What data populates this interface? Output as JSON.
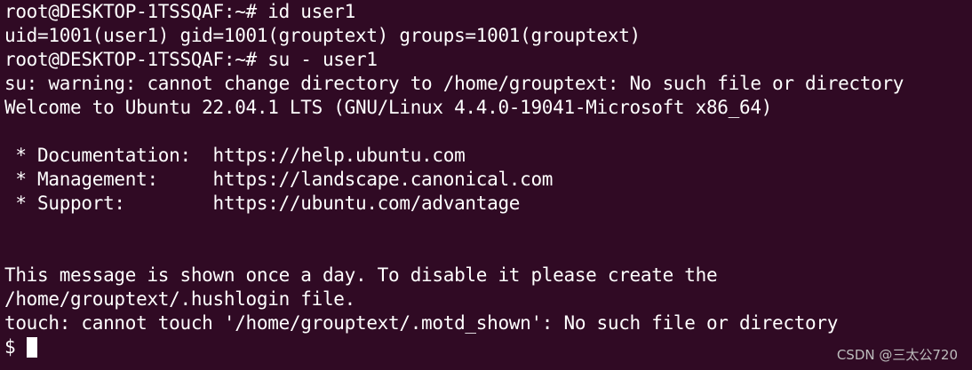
{
  "terminal": {
    "background": "#300a24",
    "foreground": "#ffffff",
    "lines": [
      "root@DESKTOP-1TSSQAF:~# id user1",
      "uid=1001(user1) gid=1001(grouptext) groups=1001(grouptext)",
      "root@DESKTOP-1TSSQAF:~# su - user1",
      "su: warning: cannot change directory to /home/grouptext: No such file or directory",
      "Welcome to Ubuntu 22.04.1 LTS (GNU/Linux 4.4.0-19041-Microsoft x86_64)",
      "",
      " * Documentation:  https://help.ubuntu.com",
      " * Management:     https://landscape.canonical.com",
      " * Support:        https://ubuntu.com/advantage",
      "",
      "",
      "This message is shown once a day. To disable it please create the",
      "/home/grouptext/.hushlogin file.",
      "touch: cannot touch '/home/grouptext/.motd_shown': No such file or directory"
    ],
    "prompt": "$",
    "watermark": "CSDN @三太公720"
  }
}
